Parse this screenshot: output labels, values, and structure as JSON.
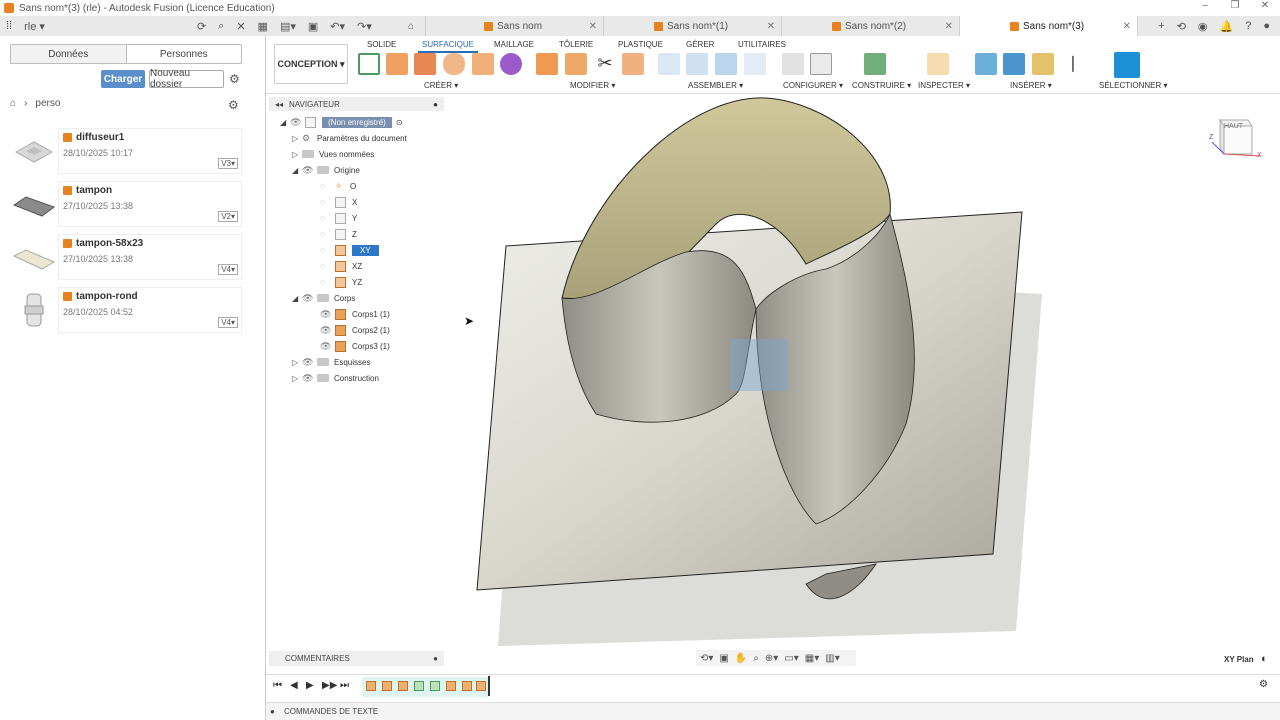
{
  "window": {
    "title": "Sans nom*(3) (rle) - Autodesk Fusion (Licence Education)"
  },
  "tabs": [
    {
      "label": "Sans nom"
    },
    {
      "label": "Sans nom*(1)"
    },
    {
      "label": "Sans nom*(2)"
    },
    {
      "label": "Sans nom*(3)"
    }
  ],
  "account": {
    "user": "rle"
  },
  "data_panel": {
    "segments": [
      "Données",
      "Personnes"
    ],
    "upload_label": "Charger",
    "new_folder_label": "Nouveau dossier",
    "breadcrumb": "perso",
    "files": [
      {
        "name": "diffuseur1",
        "date": "28/10/2025 10:17",
        "version": "V3"
      },
      {
        "name": "tampon",
        "date": "27/10/2025 13:38",
        "version": "V2"
      },
      {
        "name": "tampon-58x23",
        "date": "27/10/2025 13:38",
        "version": "V4"
      },
      {
        "name": "tampon-rond",
        "date": "28/10/2025 04:52",
        "version": "V4"
      }
    ]
  },
  "toolbar": {
    "workspace": "CONCEPTION",
    "tabs": [
      "SOLIDE",
      "SURFACIQUE",
      "MAILLAGE",
      "TÔLERIE",
      "PLASTIQUE",
      "GÉRER",
      "UTILITAIRES"
    ],
    "active_tab": "SURFACIQUE",
    "groups": [
      "CRÉER",
      "MODIFIER",
      "ASSEMBLER",
      "CONFIGURER",
      "CONSTRUIRE",
      "INSPECTER",
      "INSÉRER",
      "SÉLECTIONNER"
    ]
  },
  "navigator": {
    "title": "NAVIGATEUR",
    "root": "(Non enregistré)",
    "items": {
      "params": "Paramètres du document",
      "views": "Vues nommées",
      "origin": "Origine",
      "o": "O",
      "x": "X",
      "y": "Y",
      "z": "Z",
      "xy": "XY",
      "xz": "XZ",
      "yz": "YZ",
      "corps": "Corps",
      "corps1": "Corps1 (1)",
      "corps2a": "Corps2 (1)",
      "corps2b": "Corps3 (1)",
      "esquisses": "Esquisses",
      "construction": "Construction"
    }
  },
  "viewcube": {
    "face": "HAUT",
    "axis_z": "Z",
    "axis_x": "X"
  },
  "comments": {
    "label": "COMMENTAIRES"
  },
  "view_status": "XY Plan",
  "status_bar": {
    "label": "COMMANDES DE TEXTE"
  },
  "colors": {
    "accent": "#2b6cbd",
    "brand": "#e8821e",
    "button": "#5b8fcc"
  }
}
